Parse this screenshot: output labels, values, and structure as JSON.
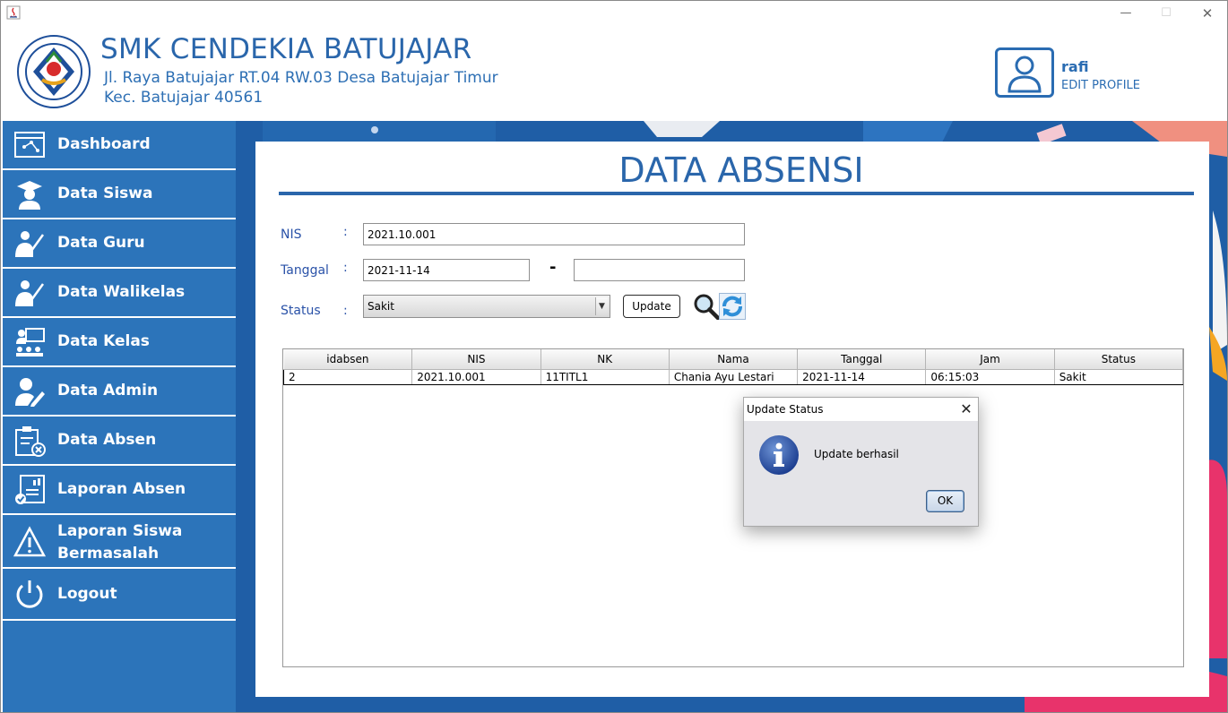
{
  "window": {
    "controls": {
      "minimize": "—",
      "maximize": "☐",
      "close": "✕"
    }
  },
  "header": {
    "school_name": "SMK CENDEKIA BATUJAJAR",
    "address_line1": "Jl. Raya Batujajar RT.04 RW.03 Desa Batujajar Timur",
    "address_line2": "Kec. Batujajar 40561",
    "user_name": "rafi",
    "edit_profile": "EDIT PROFILE"
  },
  "sidebar": {
    "items": [
      {
        "label": "Dashboard",
        "icon": "dashboard-icon"
      },
      {
        "label": "Data Siswa",
        "icon": "student-icon"
      },
      {
        "label": "Data Guru",
        "icon": "teacher-icon"
      },
      {
        "label": "Data Walikelas",
        "icon": "homeroom-teacher-icon"
      },
      {
        "label": "Data Kelas",
        "icon": "classroom-icon"
      },
      {
        "label": "Data Admin",
        "icon": "admin-icon"
      },
      {
        "label": "Data Absen",
        "icon": "attendance-icon"
      },
      {
        "label": "Laporan Absen",
        "icon": "report-icon"
      },
      {
        "label": "Laporan Siswa Bermasalah",
        "icon": "warning-icon"
      },
      {
        "label": "Logout",
        "icon": "power-icon"
      }
    ]
  },
  "main": {
    "title": "DATA ABSENSI",
    "form": {
      "nis_label": "NIS",
      "nis_value": "2021.10.001",
      "tanggal_label": "Tanggal",
      "tanggal_from": "2021-11-14",
      "tanggal_separator": "-",
      "tanggal_to": "",
      "status_label": "Status",
      "status_value": "Sakit",
      "colon": ":",
      "update_button": "Update",
      "combo_arrow": "▼"
    },
    "table": {
      "columns": [
        "idabsen",
        "NIS",
        "NK",
        "Nama",
        "Tanggal",
        "Jam",
        "Status"
      ],
      "rows": [
        [
          "2",
          "2021.10.001",
          "11TITL1",
          "Chania Ayu Lestari",
          "2021-11-14",
          "06:15:03",
          "Sakit"
        ]
      ]
    }
  },
  "dialog": {
    "title": "Update Status",
    "close": "✕",
    "message": "Update berhasil",
    "ok": "OK"
  },
  "colors": {
    "brand_blue": "#2a66ab",
    "sidebar_blue": "#2c74ba",
    "label_blue": "#2a52a8"
  }
}
